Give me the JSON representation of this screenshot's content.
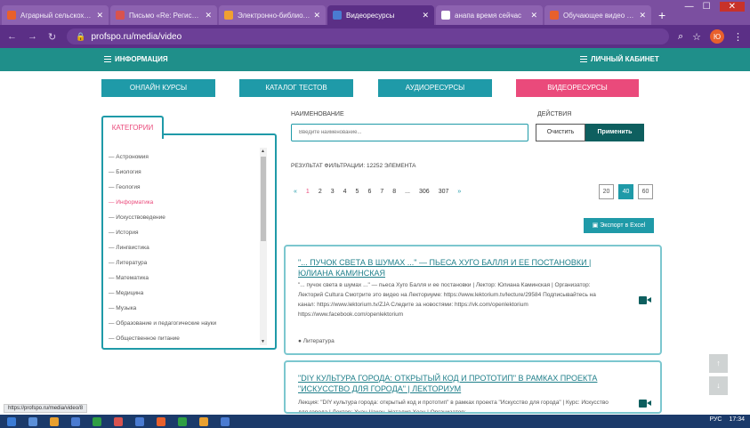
{
  "browser": {
    "tabs": [
      {
        "label": "Аграрный сельскохозяй",
        "color": "#e8602c"
      },
      {
        "label": "Письмо «Re: Регистрац",
        "color": "#d9534f"
      },
      {
        "label": "Электронно-библиотеч",
        "color": "#f0a030"
      },
      {
        "label": "Видеоресурсы",
        "color": "#4a7bd1",
        "active": true
      },
      {
        "label": "анапа время сейчас",
        "color": "#ffffff"
      },
      {
        "label": "Обучающее видео для",
        "color": "#e8602c"
      }
    ],
    "new_tab": "+",
    "url": "profspo.ru/media/video",
    "avatar_letter": "Ю"
  },
  "header": {
    "left": "ИНФОРМАЦИЯ",
    "right": "ЛИЧНЫЙ КАБИНЕТ"
  },
  "nav_buttons": {
    "online": "ОНЛАЙН КУРСЫ",
    "tests": "КАТАЛОГ ТЕСТОВ",
    "audio": "АУДИОРЕСУРСЫ",
    "video": "ВИДЕОРЕСУРСЫ"
  },
  "categories": {
    "title": "КАТЕГОРИИ",
    "items": [
      "— Астрономия",
      "— Биология",
      "— Геология",
      "— Информатика",
      "— Искусствоведение",
      "— История",
      "— Лингвистика",
      "— Литература",
      "— Математика",
      "— Медицина",
      "— Музыка",
      "— Образование и педагогические науки",
      "— Общественное питание"
    ],
    "selected_index": 3
  },
  "filter": {
    "name_label": "НАИМЕНОВАНИЕ",
    "name_placeholder": "Введите наименование...",
    "actions_label": "ДЕЙСТВИЯ",
    "clear": "Очистить",
    "apply": "Применить",
    "result": "РЕЗУЛЬТАТ ФИЛЬТРАЦИИ: 12252 ЭЛЕМЕНТА"
  },
  "pagination": {
    "prev": "«",
    "pages": [
      "1",
      "2",
      "3",
      "4",
      "5",
      "6",
      "7",
      "8",
      "...",
      "306",
      "307"
    ],
    "next": "»",
    "per_page": [
      "20",
      "40",
      "60"
    ],
    "per_page_active": "40"
  },
  "export_label": "Экспорт в Excel",
  "cards": [
    {
      "title": "\"... ПУЧОК СВЕТА В ШУМАХ ...\" — ПЬЕСА ХУГО БАЛЛЯ И ЕЕ ПОСТАНОВКИ | ЮЛИАНА КАМИНСКАЯ",
      "description": "\"... пучок света в шумах ...\" — пьеса Хуго Балля и ее постановки | Лектор: Юлиана Каминская | Организатор: Лекторий Cultura Смотрите это видео на Лекториуме: https://www.lektorium.tv/lecture/29584 Подписывайтесь на канал: https://www.lektorium.tv/ZJA Следите за новостями: https://vk.com/openlektorium https://www.facebook.com/openlektorium",
      "tag": "Литература"
    },
    {
      "title": "\"DIY КУЛЬТУРА ГОРОДА: ОТКРЫТЫЙ КОД И ПРОТОТИП\" В РАМКАХ ПРОЕКТА \"ИСКУССТВО ДЛЯ ГОРОДА\" | ЛЕКТОРИУМ",
      "description": "Лекция: \"DIY культура города: открытый код и прототип\" в рамках проекта \"Искусство для города\" | Курс: Искусство для города | Лектор: Хуан Чакон, Наталия Хоэн | Организатор:"
    }
  ],
  "status_url": "https://profspo.ru/media/video/8",
  "taskbar": {
    "lang": "РУС",
    "time": "17:34"
  }
}
